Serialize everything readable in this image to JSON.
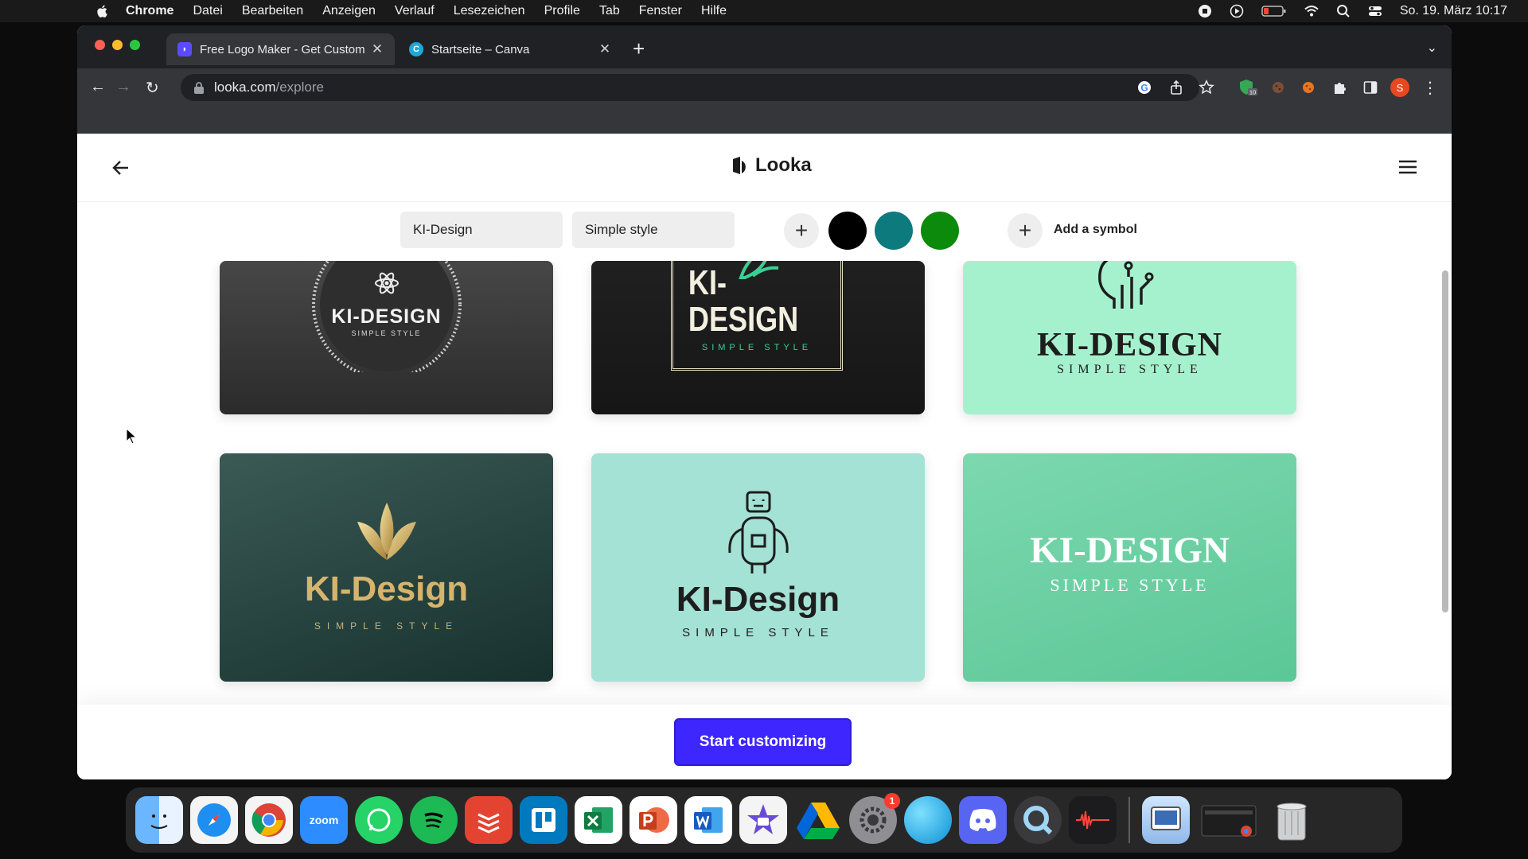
{
  "menubar": {
    "app_name": "Chrome",
    "items": [
      "Datei",
      "Bearbeiten",
      "Anzeigen",
      "Verlauf",
      "Lesezeichen",
      "Profile",
      "Tab",
      "Fenster",
      "Hilfe"
    ],
    "datetime": "So. 19. März 10:17"
  },
  "browser": {
    "tabs": [
      {
        "title": "Free Logo Maker - Get Custom",
        "favicon": "looka-favicon"
      },
      {
        "title": "Startseite – Canva",
        "favicon": "canva-favicon"
      }
    ],
    "url_host": "looka.com",
    "url_path": "/explore",
    "profile_initial": "S",
    "extension_badge": "10"
  },
  "looka": {
    "brand": "Looka",
    "filters": {
      "name_chip": "KI-Design",
      "style_chip": "Simple style",
      "swatches": [
        "#000000",
        "#0d7a7d",
        "#0b8a0b"
      ],
      "add_symbol_label": "Add a symbol"
    },
    "cards": [
      {
        "title": "KI-DESIGN",
        "subtitle": "SIMPLE STYLE"
      },
      {
        "title": "KI-DESIGN",
        "subtitle": "SIMPLE STYLE"
      },
      {
        "title": "KI-DESIGN",
        "subtitle": "SIMPLE STYLE"
      },
      {
        "title": "KI-Design",
        "subtitle": "SIMPLE STYLE"
      },
      {
        "title": "KI-Design",
        "subtitle": "SIMPLE STYLE"
      },
      {
        "title": "KI-DESIGN",
        "subtitle": "SIMPLE STYLE"
      }
    ],
    "cta": "Start customizing"
  },
  "dock": {
    "apps": [
      "finder",
      "safari",
      "chrome",
      "zoom",
      "whatsapp",
      "spotify",
      "todoist",
      "trello",
      "excel",
      "powerpoint",
      "word",
      "imovie",
      "google-drive",
      "system-settings",
      "sphere",
      "discord",
      "quicktime",
      "audio-recorder",
      "preview",
      "window-thumbnail",
      "trash"
    ],
    "zoom_label": "zoom",
    "settings_badge": "1"
  },
  "colors": {
    "accent": "#3d26ff",
    "tab_active": "#35363a",
    "tab_bar": "#202124"
  }
}
